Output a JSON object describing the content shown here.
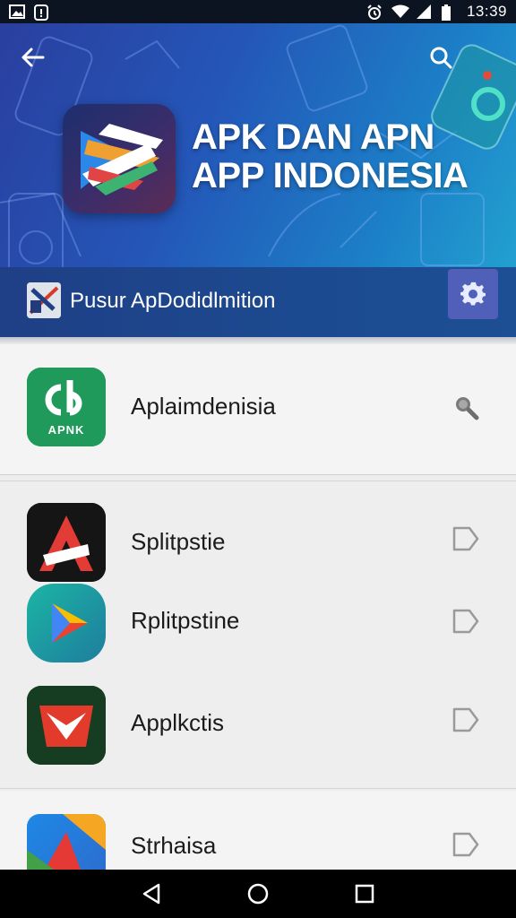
{
  "status_bar": {
    "time": "13:39",
    "icons": [
      "gallery-icon",
      "notification-icon",
      "alarm-icon",
      "wifi-icon",
      "signal-icon",
      "battery-icon"
    ]
  },
  "header": {
    "back_icon": "arrow-left-icon",
    "search_icon": "search-icon",
    "title_line1": "APK DAN APN",
    "title_line2": "APP INDONESIA",
    "logo_icon": "app-store-logo-icon"
  },
  "subheader": {
    "label": "Pusur ApDodidlmition",
    "settings_icon": "settings-gear-icon"
  },
  "list": {
    "featured": {
      "name": "Aplaimdenisia",
      "icon_text": "APNK",
      "action_icon": "search-icon"
    },
    "items": [
      {
        "name": "Splitpstie",
        "action_icon": "tag-arrow-icon"
      },
      {
        "name": "Rplitpstine",
        "action_icon": "tag-arrow-icon"
      },
      {
        "name": "Applkctis",
        "action_icon": "tag-arrow-icon"
      },
      {
        "name": "Strhaisa",
        "action_icon": "tag-arrow-icon"
      }
    ]
  },
  "nav": {
    "icons": [
      "back-triangle-icon",
      "home-circle-icon",
      "recents-square-icon"
    ]
  },
  "colors": {
    "banner_start": "#2a3f9f",
    "banner_end": "#22a0d0",
    "subbar": "#1f3f86",
    "settings_button": "#5060b8",
    "apk_green": "#1f9a5a"
  }
}
